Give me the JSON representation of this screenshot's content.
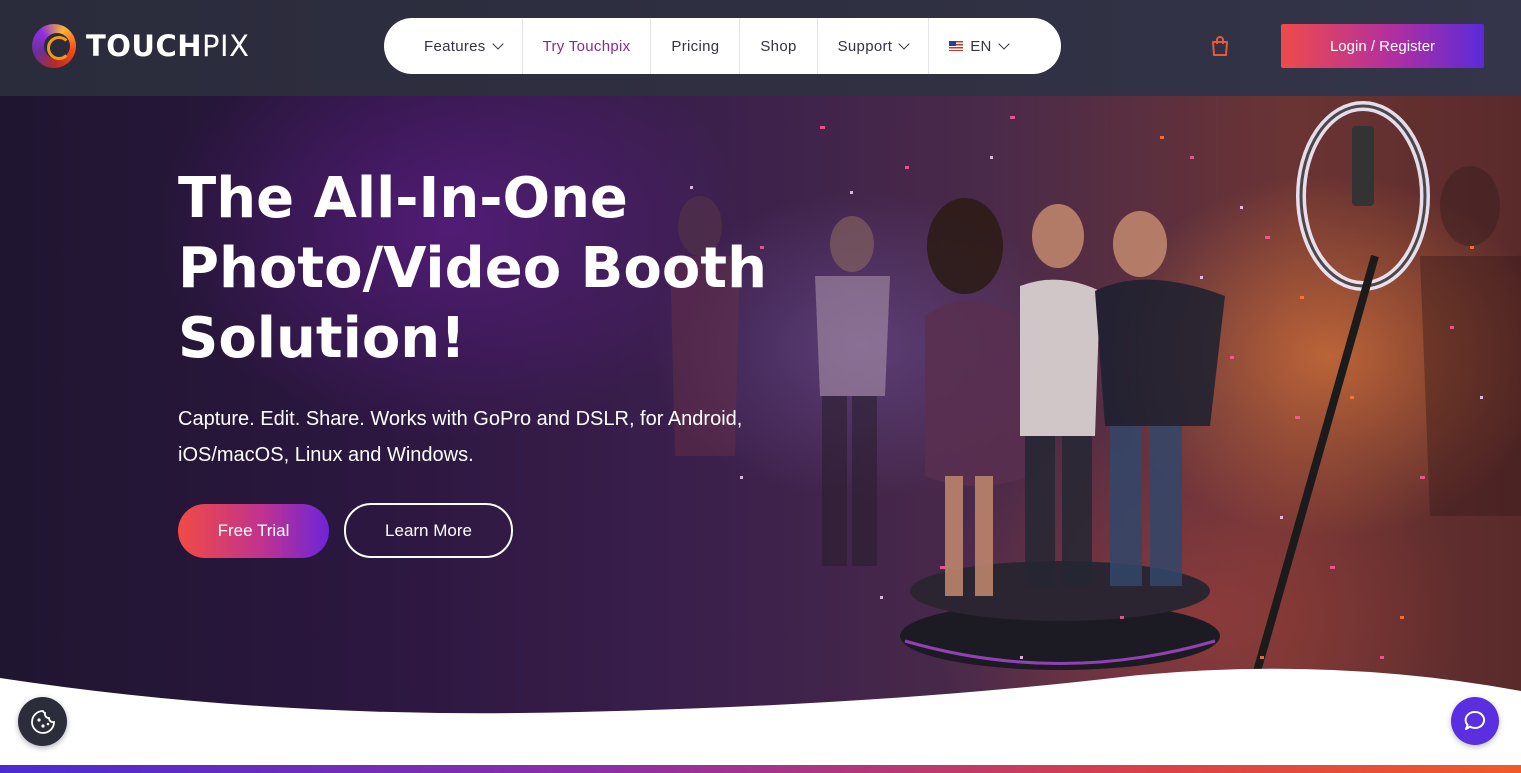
{
  "brand": {
    "part1": "TOUCH",
    "part2": "PIX"
  },
  "nav": {
    "items": [
      {
        "label": "Features",
        "dropdown": true,
        "active": false
      },
      {
        "label": "Try Touchpix",
        "dropdown": false,
        "active": true
      },
      {
        "label": "Pricing",
        "dropdown": false,
        "active": false
      },
      {
        "label": "Shop",
        "dropdown": false,
        "active": false
      },
      {
        "label": "Support",
        "dropdown": true,
        "active": false
      }
    ],
    "language": {
      "label": "EN",
      "flag": "us-flag-icon"
    },
    "cart_icon": "shopping-bag-icon",
    "login_label": "Login / Register"
  },
  "hero": {
    "title_line1": "The All-In-One",
    "title_line2": "Photo/Video Booth",
    "title_line3": "Solution!",
    "subtitle_line1": "Capture. Edit. Share. Works with GoPro and DSLR, for Android,",
    "subtitle_line2": "iOS/macOS, Linux and Windows.",
    "primary_button": "Free Trial",
    "secondary_button": "Learn More"
  },
  "floating": {
    "cookie_icon": "cookie-icon",
    "chat_icon": "chat-bubble-icon"
  },
  "colors": {
    "header_bg": "#2e2f41",
    "accent_start": "#ef4b4b",
    "accent_end": "#5b2bd8",
    "active_nav": "#8a2a8f"
  }
}
